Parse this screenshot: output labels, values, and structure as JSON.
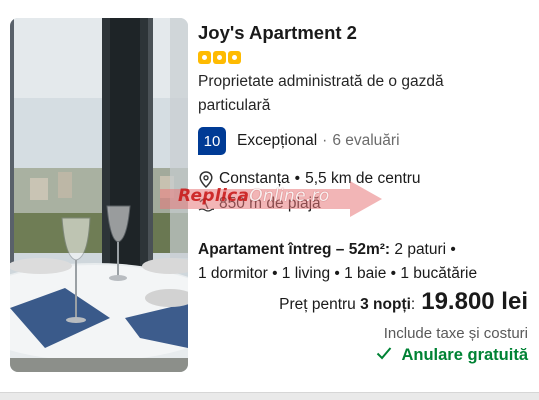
{
  "listing": {
    "name": "Joy's Apartment 2",
    "rating_squares": 3,
    "host_type": "Proprietate administrată de o gazdă particulară",
    "review": {
      "score": "10",
      "word": "Excepțional",
      "separator": "·",
      "count_text": "6 evaluări"
    },
    "location": {
      "city": "Constanța",
      "separator": "•",
      "distance_text": "5,5 km de centru"
    },
    "beach_distance": "850 m de plajă",
    "unit": {
      "type_bold": "Apartament întreg – 52m²:",
      "line1_rest": "2 paturi •",
      "line2": "1 dormitor • 1 living • 1 baie • 1 bucătărie"
    },
    "price": {
      "label_prefix": "Preț pentru",
      "nights_bold": "3 nopți",
      "colon": ":",
      "amount": "19.800 lei",
      "taxes_note": "Include taxe și costuri"
    },
    "cancellation": "Anulare gratuită"
  },
  "watermark": {
    "part1": "Replica",
    "part2": "Online.ro"
  },
  "icons": {
    "location": "map-pin-icon",
    "beach": "beach-icon",
    "check": "checkmark-icon",
    "stars": "rating-square-icon"
  },
  "colors": {
    "score_badge": "#003b95",
    "rating_squares": "#febb02",
    "free_cancellation": "#008234",
    "watermark_red": "#c81414"
  }
}
